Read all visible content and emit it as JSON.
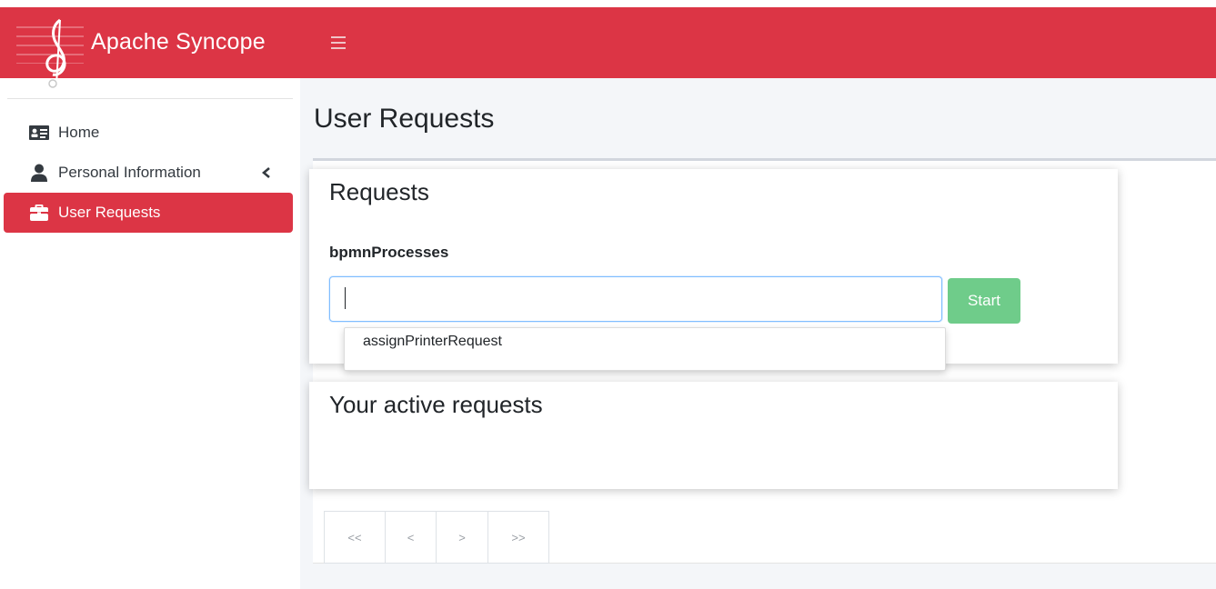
{
  "brand": {
    "name": "Apache Syncope",
    "color": "#dc3545"
  },
  "sidebar": {
    "items": [
      {
        "label": "Home",
        "icon": "id-card-icon",
        "active": false
      },
      {
        "label": "Personal Information",
        "icon": "user-icon",
        "active": false,
        "expandable": true
      },
      {
        "label": "User Requests",
        "icon": "briefcase-icon",
        "active": true
      }
    ]
  },
  "page": {
    "title": "User Requests"
  },
  "requests": {
    "title": "Requests",
    "field_label": "bpmnProcesses",
    "input_value": "",
    "start_label": "Start",
    "suggestions": [
      "assignPrinterRequest"
    ]
  },
  "active_requests": {
    "title": "Your active requests"
  },
  "pagination": {
    "first": "<<",
    "prev": "<",
    "next": ">",
    "last": ">>"
  },
  "colors": {
    "accent": "#dc3545",
    "success": "#6fcc8a",
    "content_bg": "#f4f6f9"
  }
}
